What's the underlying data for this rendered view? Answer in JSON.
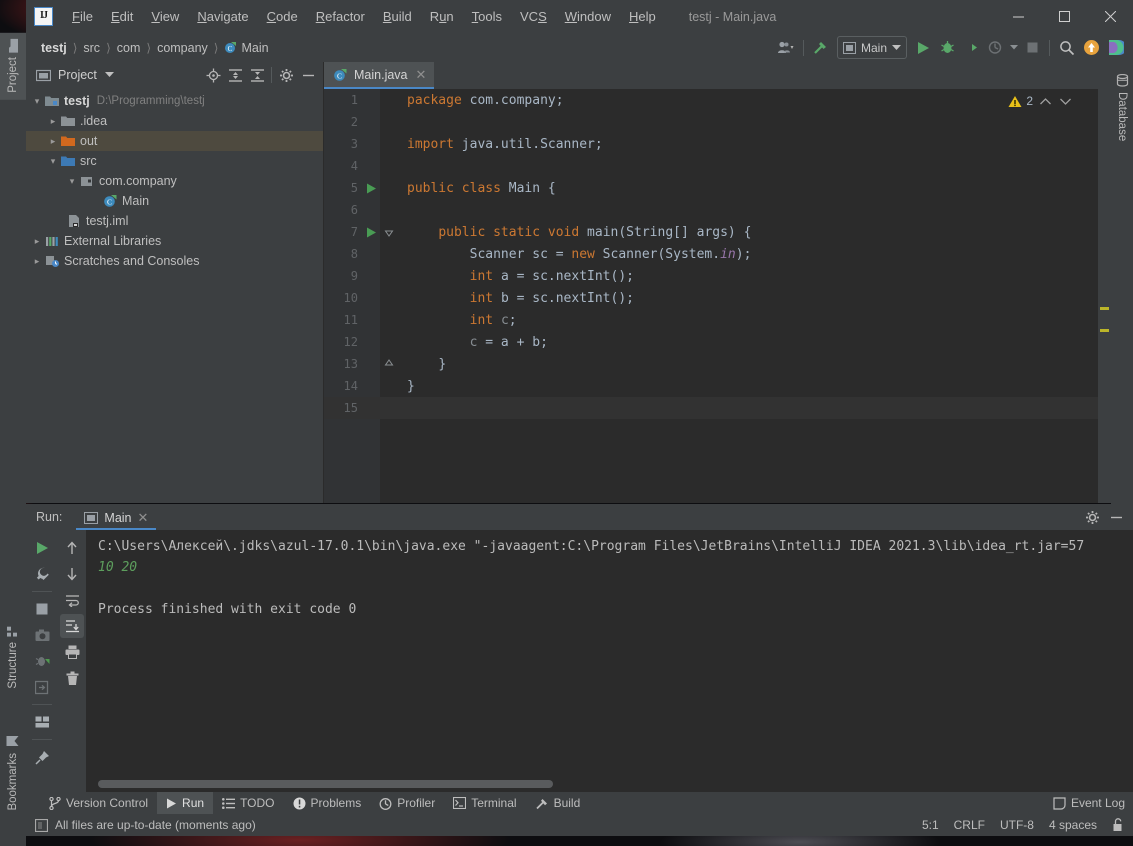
{
  "window": {
    "title": "testj - Main.java",
    "logo_text": "IJ",
    "minimize": "—",
    "maximize": "☐",
    "close": "✕"
  },
  "menu": [
    {
      "label": "File",
      "mnemonic": "F"
    },
    {
      "label": "Edit",
      "mnemonic": "E"
    },
    {
      "label": "View",
      "mnemonic": "V"
    },
    {
      "label": "Navigate",
      "mnemonic": "N"
    },
    {
      "label": "Code",
      "mnemonic": "C"
    },
    {
      "label": "Refactor",
      "mnemonic": "R"
    },
    {
      "label": "Build",
      "mnemonic": "B"
    },
    {
      "label": "Run",
      "mnemonic": "R"
    },
    {
      "label": "Tools",
      "mnemonic": "T"
    },
    {
      "label": "VCS",
      "mnemonic": "S"
    },
    {
      "label": "Window",
      "mnemonic": "W"
    },
    {
      "label": "Help",
      "mnemonic": "H"
    }
  ],
  "breadcrumb": [
    {
      "label": "testj",
      "bold": true
    },
    {
      "label": "src",
      "bold": false
    },
    {
      "label": "com",
      "bold": false
    },
    {
      "label": "company",
      "bold": false
    },
    {
      "label": "Main",
      "bold": false,
      "icon": "java-class-icon"
    }
  ],
  "navbar_toolbar": {
    "run_config": "Main",
    "icons": [
      "user-avatar-icon",
      "hammer-build-icon",
      "run-icon",
      "debug-icon",
      "run-coverage-icon",
      "profile-icon",
      "stop-icon",
      "search-everywhere-icon",
      "updates-icon",
      "ide-assistant-icon"
    ]
  },
  "left_tool_strip": [
    {
      "label": "Project",
      "icon": "project-folder-icon",
      "active": true
    },
    {
      "label": "Structure",
      "icon": "structure-icon",
      "active": false
    },
    {
      "label": "Bookmarks",
      "icon": "bookmark-icon",
      "active": false
    }
  ],
  "right_tool_strip": [
    {
      "label": "Database",
      "icon": "database-icon"
    }
  ],
  "project_panel": {
    "title": "Project",
    "toolbar": [
      "locate-target-icon",
      "expand-all-icon",
      "collapse-all-icon",
      "settings-gear-icon",
      "hide-panel-icon"
    ],
    "tree": [
      {
        "label": "testj",
        "path": "D:\\Programming\\testj",
        "indent": 0,
        "arrow": "down",
        "icon": "module-icon",
        "bold": true,
        "selected": false
      },
      {
        "label": ".idea",
        "path": "",
        "indent": 1,
        "arrow": "right",
        "icon": "folder-icon",
        "bold": false,
        "selected": false
      },
      {
        "label": "out",
        "path": "",
        "indent": 1,
        "arrow": "right",
        "icon": "folder-orange-icon",
        "bold": false,
        "selected": true
      },
      {
        "label": "src",
        "path": "",
        "indent": 1,
        "arrow": "down",
        "icon": "folder-source-icon",
        "bold": false,
        "selected": false
      },
      {
        "label": "com.company",
        "path": "",
        "indent": 2,
        "arrow": "down",
        "icon": "package-icon",
        "bold": false,
        "selected": false
      },
      {
        "label": "Main",
        "path": "",
        "indent": 3,
        "arrow": "none",
        "icon": "java-class-icon",
        "bold": false,
        "selected": false
      },
      {
        "label": "testj.iml",
        "path": "",
        "indent": 1,
        "arrow": "none",
        "icon": "iml-file-icon",
        "bold": false,
        "selected": false
      },
      {
        "label": "External Libraries",
        "path": "",
        "indent": 0,
        "arrow": "right",
        "icon": "libraries-icon",
        "bold": false,
        "selected": false
      },
      {
        "label": "Scratches and Consoles",
        "path": "",
        "indent": 0,
        "arrow": "right",
        "icon": "scratches-icon",
        "bold": false,
        "selected": false
      }
    ]
  },
  "editor": {
    "tab": {
      "label": "Main.java",
      "icon": "java-class-icon",
      "close": "✕"
    },
    "inspection": {
      "warning_count": "2",
      "icon": "warning-triangle-icon",
      "prev": "⌃",
      "next": "⌄"
    },
    "caret_line": 15,
    "code_lines": [
      {
        "num": "1",
        "html": "<span class='k'>package</span> <span class='t'>com.company;</span>",
        "gutter": "none",
        "fold": "none"
      },
      {
        "num": "2",
        "html": "",
        "gutter": "none",
        "fold": "none"
      },
      {
        "num": "3",
        "html": "<span class='k'>import</span> <span class='t'>java.util.Scanner;</span>",
        "gutter": "none",
        "fold": "none"
      },
      {
        "num": "4",
        "html": "",
        "gutter": "none",
        "fold": "none"
      },
      {
        "num": "5",
        "html": "<span class='k'>public</span> <span class='k'>class</span> <span class='t'>Main {</span>",
        "gutter": "run",
        "fold": "none"
      },
      {
        "num": "6",
        "html": "",
        "gutter": "none",
        "fold": "none"
      },
      {
        "num": "7",
        "html": "    <span class='k'>public</span> <span class='k'>static</span> <span class='k'>void</span> <span class='t'>main(String[] args) {</span>",
        "gutter": "run",
        "fold": "open"
      },
      {
        "num": "8",
        "html": "        <span class='t'>Scanner sc = </span><span class='k'>new</span><span class='t'> Scanner(System.</span><span class='it'>in</span><span class='t'>);</span>",
        "gutter": "none",
        "fold": "none"
      },
      {
        "num": "9",
        "html": "        <span class='k'>int</span> <span class='t'>a = sc.nextInt();</span>",
        "gutter": "none",
        "fold": "none"
      },
      {
        "num": "10",
        "html": "        <span class='k'>int</span> <span class='t'>b = sc.nextInt();</span>",
        "gutter": "none",
        "fold": "none"
      },
      {
        "num": "11",
        "html": "        <span class='k'>int</span> <span class='unused'>c</span><span class='t'>;</span>",
        "gutter": "none",
        "fold": "none"
      },
      {
        "num": "12",
        "html": "        <span class='unused'>c</span><span class='t'> = a + b;</span>",
        "gutter": "none",
        "fold": "none"
      },
      {
        "num": "13",
        "html": "    <span class='t'>}</span>",
        "gutter": "none",
        "fold": "close"
      },
      {
        "num": "14",
        "html": "<span class='t'>}</span>",
        "gutter": "none",
        "fold": "none"
      },
      {
        "num": "15",
        "html": "",
        "gutter": "none",
        "fold": "none"
      }
    ],
    "error_stripe_marks": [
      "#bbb529",
      "#bbb529"
    ]
  },
  "run_panel": {
    "label": "Run:",
    "tab": {
      "label": "Main",
      "icon": "run-config-icon",
      "close": "✕"
    },
    "header_tools": [
      "settings-gear-icon",
      "hide-panel-icon"
    ],
    "left_tools": [
      "rerun-icon",
      "wrench-settings-icon",
      "stop-icon",
      "screenshot-icon",
      "dump-threads-icon",
      "export-icon",
      "layout-icon",
      "pin-tab-icon"
    ],
    "left_tools_2": [
      "scroll-up-icon",
      "scroll-down-icon",
      "soft-wrap-icon",
      "scroll-to-end-icon",
      "print-icon",
      "clear-all-icon"
    ],
    "console_lines": [
      {
        "text": "C:\\Users\\Алексей\\.jdks\\azul-17.0.1\\bin\\java.exe \"-javaagent:C:\\Program Files\\JetBrains\\IntelliJ IDEA 2021.3\\lib\\idea_rt.jar=57",
        "style": "normal"
      },
      {
        "text": "10 20",
        "style": "input"
      },
      {
        "text": "",
        "style": "normal"
      },
      {
        "text": "Process finished with exit code 0",
        "style": "normal"
      }
    ]
  },
  "bottom_bar": {
    "items": [
      {
        "label": "Version Control",
        "icon": "vcs-branch-icon",
        "active": false
      },
      {
        "label": "Run",
        "icon": "run-icon",
        "active": true
      },
      {
        "label": "TODO",
        "icon": "todo-list-icon",
        "active": false
      },
      {
        "label": "Problems",
        "icon": "problems-icon",
        "active": false
      },
      {
        "label": "Profiler",
        "icon": "profiler-icon",
        "active": false
      },
      {
        "label": "Terminal",
        "icon": "terminal-icon",
        "active": false
      },
      {
        "label": "Build",
        "icon": "hammer-build-icon",
        "active": false
      }
    ],
    "event_log": {
      "label": "Event Log",
      "icon": "event-log-icon"
    }
  },
  "status_bar": {
    "message": "All files are up-to-date (moments ago)",
    "message_icon": "ide-status-icon",
    "caret_position": "5:1",
    "line_separator": "CRLF",
    "encoding": "UTF-8",
    "indent": "4 spaces",
    "lock_icon": "unlocked-icon"
  },
  "colors": {
    "panel": "#3c3f41",
    "editor_bg": "#2b2b2b",
    "accent_blue": "#4a88c7",
    "keyword_orange": "#cc7832",
    "text_gray": "#a9b7c6",
    "warning_yellow": "#bbb529",
    "run_green": "#499c54",
    "selected_row": "#4e4a3f"
  }
}
